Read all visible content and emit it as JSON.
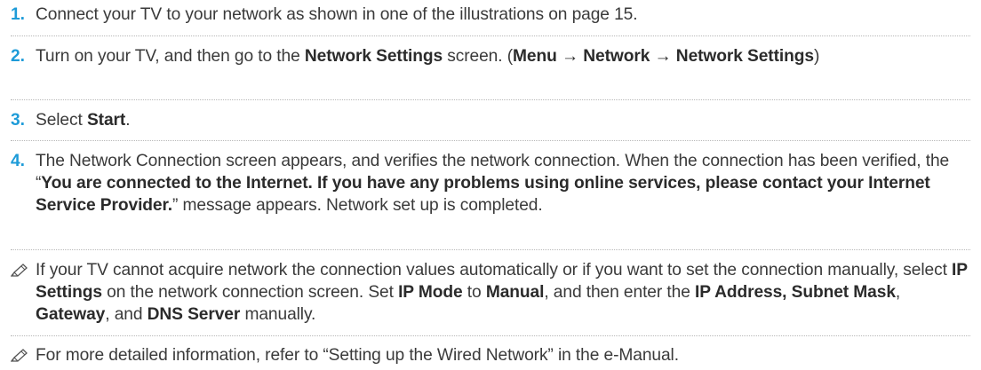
{
  "steps": [
    {
      "number": "1.",
      "text": [
        {
          "t": "Connect your TV to your network as shown in one of the illustrations on page 15."
        }
      ]
    },
    {
      "number": "2.",
      "text": [
        {
          "t": "Turn on your TV, and then go to the "
        },
        {
          "t": "Network Settings",
          "b": true
        },
        {
          "t": " screen. ("
        },
        {
          "t": "Menu → Network → Network Settings",
          "b": true
        },
        {
          "t": ")"
        }
      ]
    },
    {
      "number": "3.",
      "text": [
        {
          "t": "Select "
        },
        {
          "t": "Start",
          "b": true
        },
        {
          "t": "."
        }
      ]
    },
    {
      "number": "4.",
      "text": [
        {
          "t": "The Network Connection screen appears, and verifies the network connection. When the connection has been verified, the “"
        },
        {
          "t": "You are connected to the Internet. If you have any problems using online services, please contact your Internet Service Provider.",
          "b": true
        },
        {
          "t": "” message appears. Network set up is completed."
        }
      ]
    }
  ],
  "notes": [
    {
      "icon": "pencil-note-icon",
      "text": [
        {
          "t": "If your TV cannot acquire network the connection values automatically or if you want to set the connection manually, select "
        },
        {
          "t": "IP Settings",
          "b": true
        },
        {
          "t": " on the network connection screen. Set "
        },
        {
          "t": "IP Mode",
          "b": true
        },
        {
          "t": " to "
        },
        {
          "t": "Manual",
          "b": true
        },
        {
          "t": ", and then enter the "
        },
        {
          "t": "IP Address, Subnet Mask",
          "b": true
        },
        {
          "t": ", "
        },
        {
          "t": "Gateway",
          "b": true
        },
        {
          "t": ", and "
        },
        {
          "t": "DNS Server",
          "b": true
        },
        {
          "t": " manually."
        }
      ]
    },
    {
      "icon": "pencil-note-icon",
      "text": [
        {
          "t": "For more detailed information, refer to “Setting up the Wired Network” in the e-Manual."
        }
      ]
    }
  ],
  "colors": {
    "step_number": "#1d9bd8",
    "body_text": "#3a3a3a",
    "separator": "#b8b8b8"
  }
}
